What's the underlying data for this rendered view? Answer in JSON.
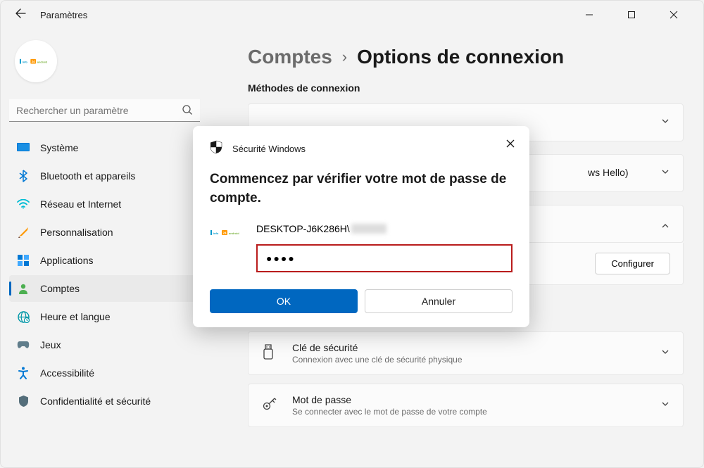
{
  "window": {
    "title": "Paramètres"
  },
  "search": {
    "placeholder": "Rechercher un paramètre"
  },
  "nav": {
    "items": [
      {
        "label": "Système"
      },
      {
        "label": "Bluetooth et appareils"
      },
      {
        "label": "Réseau et Internet"
      },
      {
        "label": "Personnalisation"
      },
      {
        "label": "Applications"
      },
      {
        "label": "Comptes"
      },
      {
        "label": "Heure et langue"
      },
      {
        "label": "Jeux"
      },
      {
        "label": "Accessibilité"
      },
      {
        "label": "Confidentialité et sécurité"
      }
    ]
  },
  "breadcrumb": {
    "parent": "Comptes",
    "current": "Options de connexion"
  },
  "section": {
    "title": "Méthodes de connexion"
  },
  "cards": {
    "hello": {
      "title_suffix": "ws Hello)"
    },
    "configure_label": "Configurer",
    "security_key": {
      "title": "Clé de sécurité",
      "sub": "Connexion avec une clé de sécurité physique"
    },
    "password": {
      "title": "Mot de passe",
      "sub": "Se connecter avec le mot de passe de votre compte"
    }
  },
  "dialog": {
    "title": "Sécurité Windows",
    "heading": "Commencez par vérifier votre mot de passe de compte.",
    "username": "DESKTOP-J6K286H\\",
    "password_mask": "●●●●",
    "ok": "OK",
    "cancel": "Annuler"
  }
}
